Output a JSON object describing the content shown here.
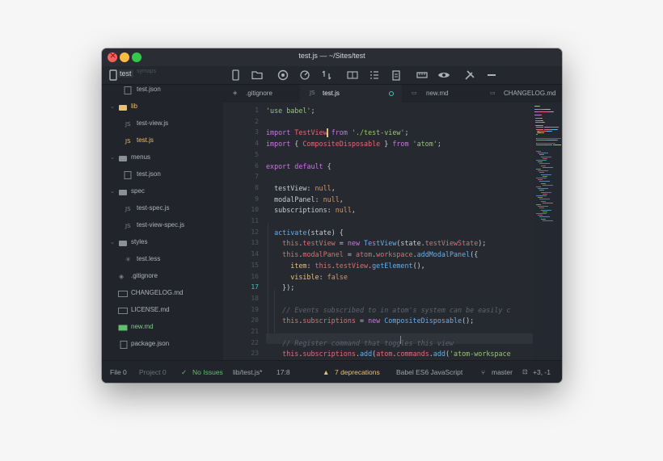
{
  "window": {
    "title": "test.js — ~/Sites/test",
    "project_name": "test",
    "hidden_label": "symaps"
  },
  "toolbar": {
    "icons": [
      "device-mobile-icon",
      "folder-icon",
      "github-icon",
      "dashboard-icon",
      "git-compare-icon",
      "book-icon",
      "list-icon",
      "clipboard-icon",
      "ruler-icon",
      "eye-icon",
      "tools-icon",
      "dash-icon"
    ]
  },
  "tree": {
    "items": [
      {
        "label": "test.json",
        "type": "file",
        "icon": "json-file-icon",
        "depth": 2
      },
      {
        "label": "lib",
        "type": "folder",
        "open": true,
        "depth": 1
      },
      {
        "label": "test-view.js",
        "type": "file",
        "icon": "js-file-icon",
        "depth": 2
      },
      {
        "label": "test.js",
        "type": "file",
        "icon": "js-file-icon",
        "depth": 2,
        "active": true
      },
      {
        "label": "menus",
        "type": "folder",
        "depth": 1
      },
      {
        "label": "test.json",
        "type": "file",
        "icon": "json-file-icon",
        "depth": 2
      },
      {
        "label": "spec",
        "type": "folder",
        "depth": 1
      },
      {
        "label": "test-spec.js",
        "type": "file",
        "icon": "js-file-icon",
        "depth": 2
      },
      {
        "label": "test-view-spec.js",
        "type": "file",
        "icon": "js-file-icon",
        "depth": 2
      },
      {
        "label": "styles",
        "type": "folder",
        "depth": 1
      },
      {
        "label": "test.less",
        "type": "file",
        "icon": "less-file-icon",
        "depth": 2
      },
      {
        "label": ".gitignore",
        "type": "file",
        "icon": "gitignore-icon",
        "depth": 1
      },
      {
        "label": "CHANGELOG.md",
        "type": "file",
        "icon": "markdown-icon",
        "depth": 1
      },
      {
        "label": "LICENSE.md",
        "type": "file",
        "icon": "markdown-icon",
        "depth": 1
      },
      {
        "label": "new.md",
        "type": "file",
        "icon": "markdown-icon",
        "depth": 1,
        "added": true
      },
      {
        "label": "package.json",
        "type": "file",
        "icon": "json-file-icon",
        "depth": 1
      }
    ]
  },
  "tabs": [
    {
      "label": ".gitignore",
      "icon": "gitignore-icon"
    },
    {
      "label": "test.js",
      "icon": "js-file-icon",
      "active": true,
      "modified": true
    },
    {
      "label": "new.md",
      "icon": "markdown-icon"
    },
    {
      "label": "CHANGELOG.md",
      "icon": "markdown-icon"
    }
  ],
  "editor": {
    "active_line": 17,
    "line_numbers": [
      "1",
      "2",
      "3",
      "4",
      "5",
      "6",
      "7",
      "8",
      "9",
      "10",
      "11",
      "12",
      "13",
      "14",
      "15",
      "16",
      "17",
      "18",
      "19",
      "20",
      "21",
      "22",
      "23"
    ],
    "lines": [
      [
        [
          "s",
          "'use babel'"
        ],
        [
          "x",
          ";"
        ]
      ],
      [],
      [
        [
          "k",
          "import "
        ],
        [
          "t",
          "TestView "
        ],
        [
          "k",
          "from "
        ],
        [
          "s",
          "'./test-view'"
        ],
        [
          "x",
          ";"
        ]
      ],
      [
        [
          "k",
          "import "
        ],
        [
          "x",
          "{ "
        ],
        [
          "t",
          "CompositeDisposable "
        ],
        [
          "x",
          "} "
        ],
        [
          "k",
          "from "
        ],
        [
          "s",
          "'atom'"
        ],
        [
          "x",
          ";"
        ]
      ],
      [],
      [
        [
          "k",
          "export default "
        ],
        [
          "x",
          "{"
        ]
      ],
      [],
      [
        [
          "x",
          "  testView: "
        ],
        [
          "n",
          "null"
        ],
        [
          "x",
          ","
        ]
      ],
      [
        [
          "x",
          "  modalPanel: "
        ],
        [
          "n",
          "null"
        ],
        [
          "x",
          ","
        ]
      ],
      [
        [
          "x",
          "  subscriptions: "
        ],
        [
          "n",
          "null"
        ],
        [
          "x",
          ","
        ]
      ],
      [],
      [
        [
          "x",
          "  "
        ],
        [
          "f",
          "activate"
        ],
        [
          "x",
          "(state) {"
        ]
      ],
      [
        [
          "x",
          "    "
        ],
        [
          "t",
          "this"
        ],
        [
          "x",
          "."
        ],
        [
          "t",
          "testView"
        ],
        [
          "x",
          " = "
        ],
        [
          "k",
          "new "
        ],
        [
          "f",
          "TestView"
        ],
        [
          "x",
          "(state."
        ],
        [
          "t",
          "testViewState"
        ],
        [
          "x",
          ");"
        ]
      ],
      [
        [
          "x",
          "    "
        ],
        [
          "t",
          "this"
        ],
        [
          "x",
          "."
        ],
        [
          "t",
          "modalPanel"
        ],
        [
          "x",
          " = "
        ],
        [
          "t",
          "atom"
        ],
        [
          "x",
          "."
        ],
        [
          "t",
          "workspace"
        ],
        [
          "x",
          "."
        ],
        [
          "f",
          "addModalPanel"
        ],
        [
          "x",
          "({"
        ]
      ],
      [
        [
          "x",
          "      "
        ],
        [
          "p",
          "item"
        ],
        [
          "x",
          ": "
        ],
        [
          "t",
          "this"
        ],
        [
          "x",
          "."
        ],
        [
          "t",
          "testView"
        ],
        [
          "x",
          "."
        ],
        [
          "f",
          "getElement"
        ],
        [
          "x",
          "(),"
        ]
      ],
      [
        [
          "x",
          "      "
        ],
        [
          "p",
          "visible"
        ],
        [
          "x",
          ": "
        ],
        [
          "n",
          "false"
        ]
      ],
      [
        [
          "x",
          "    });"
        ]
      ],
      [],
      [
        [
          "x",
          "    "
        ],
        [
          "c",
          "// Events subscribed to in atom's system can be easily c"
        ]
      ],
      [
        [
          "x",
          "    "
        ],
        [
          "t",
          "this"
        ],
        [
          "x",
          "."
        ],
        [
          "t",
          "subscriptions"
        ],
        [
          "x",
          " = "
        ],
        [
          "k",
          "new "
        ],
        [
          "f",
          "CompositeDisposable"
        ],
        [
          "x",
          "();"
        ]
      ],
      [],
      [
        [
          "x",
          "    "
        ],
        [
          "c",
          "// Register command that toggles this view"
        ]
      ],
      [
        [
          "x",
          "    "
        ],
        [
          "t",
          "this"
        ],
        [
          "x",
          "."
        ],
        [
          "t",
          "subscriptions"
        ],
        [
          "x",
          "."
        ],
        [
          "f",
          "add"
        ],
        [
          "x",
          "("
        ],
        [
          "t",
          "atom"
        ],
        [
          "x",
          "."
        ],
        [
          "t",
          "commands"
        ],
        [
          "x",
          "."
        ],
        [
          "f",
          "add"
        ],
        [
          "x",
          "("
        ],
        [
          "s",
          "'atom-workspace"
        ]
      ]
    ]
  },
  "status": {
    "file_count": "File 0",
    "project_count": "Project 0",
    "linter": "No Issues",
    "path": "lib/test.js*",
    "cursor": "17:8",
    "deprecations": "7 deprecations",
    "grammar": "Babel ES6 JavaScript",
    "branch": "master",
    "diff": "+3, -1"
  },
  "colors": {
    "accent": "#49c1b3",
    "keyword": "#c678dd",
    "string": "#98c379",
    "function": "#61afef",
    "variable": "#e06c75",
    "warning": "#e5c07b",
    "success": "#5fbf6f"
  }
}
